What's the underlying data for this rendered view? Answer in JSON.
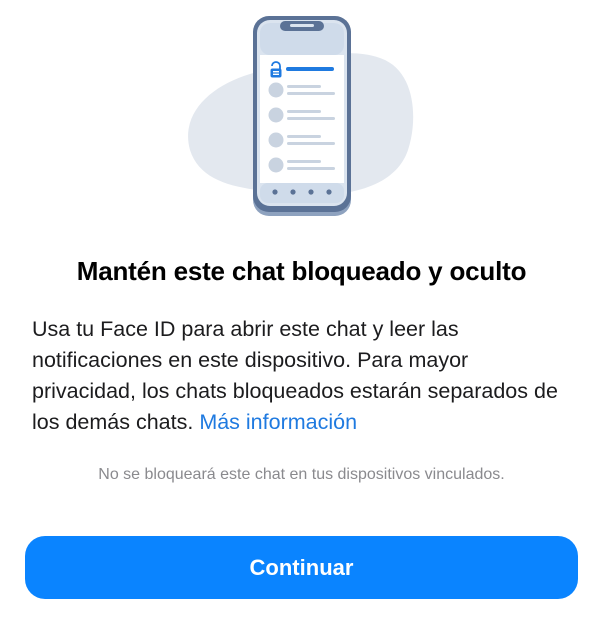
{
  "colors": {
    "accent": "#0a84ff",
    "link": "#1f7ae0",
    "illustration_blob": "#e3e8ef",
    "phone_frame": "#5b7296",
    "phone_screen": "#ffffff",
    "phone_bar": "#cfdbea",
    "list_placeholder": "#b6c4d6"
  },
  "illustration": {
    "icon": "phone-with-locked-chat-list-icon"
  },
  "title": "Mantén este chat bloqueado y oculto",
  "body": {
    "text": "Usa tu Face ID para abrir este chat y leer las notificaciones en este dispositivo. Para mayor privacidad, los chats bloqueados estarán separados de los demás chats.",
    "link_label": "Más información"
  },
  "footnote": "No se bloqueará este chat en tus dispositivos vinculados.",
  "continue_button": {
    "label": "Continuar"
  }
}
